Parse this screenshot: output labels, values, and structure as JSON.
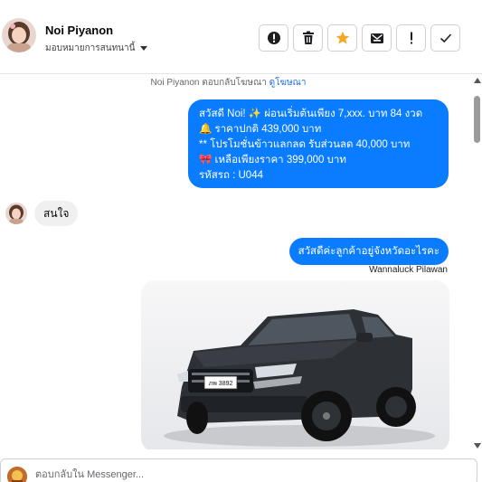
{
  "header": {
    "contact_name": "Noi Piyanon",
    "assign_label": "มอบหมายการสนทนานี้",
    "actions": [
      {
        "name": "mark-spam-button",
        "icon": "exclamation-circle-icon"
      },
      {
        "name": "delete-button",
        "icon": "trash-icon"
      },
      {
        "name": "star-button",
        "icon": "star-icon"
      },
      {
        "name": "mark-unread-button",
        "icon": "envelope-icon"
      },
      {
        "name": "flag-button",
        "icon": "exclamation-icon"
      },
      {
        "name": "mark-done-button",
        "icon": "check-icon"
      }
    ]
  },
  "chat": {
    "reply_note": {
      "text": "Noi Piyanon ตอบกลับโฆษณา",
      "link": "ดูโฆษณา"
    },
    "outgoing_promo": {
      "lines": [
        "สวัสดี Noi! ✨  ผ่อนเริ่มต้นเพียง 7,xxx. บาท 84 งวด",
        "🔔 ราคาปกติ 439,000 บาท",
        "** โปรโมชั่นข้าวแลกลด รับส่วนลด 40,000 บาท",
        "🎀  เหลือเพียงราคา 399,000 บาท",
        " รหัสรถ : U044"
      ]
    },
    "incoming_text": "สนใจ",
    "outgoing_greeting": "สวัสดีค่ะลูกค้าอยู่จังหวัดอะไรคะ",
    "sender_name": "Wannaluck Pilawan",
    "photo": {
      "plate": "ภพ 3892"
    }
  },
  "composer": {
    "placeholder": "ตอบกลับใน Messenger..."
  },
  "colors": {
    "outgoing_bubble": "#0a7cff",
    "incoming_bubble": "#f0f0f0",
    "star": "#f5a623",
    "link": "#216fdb"
  }
}
